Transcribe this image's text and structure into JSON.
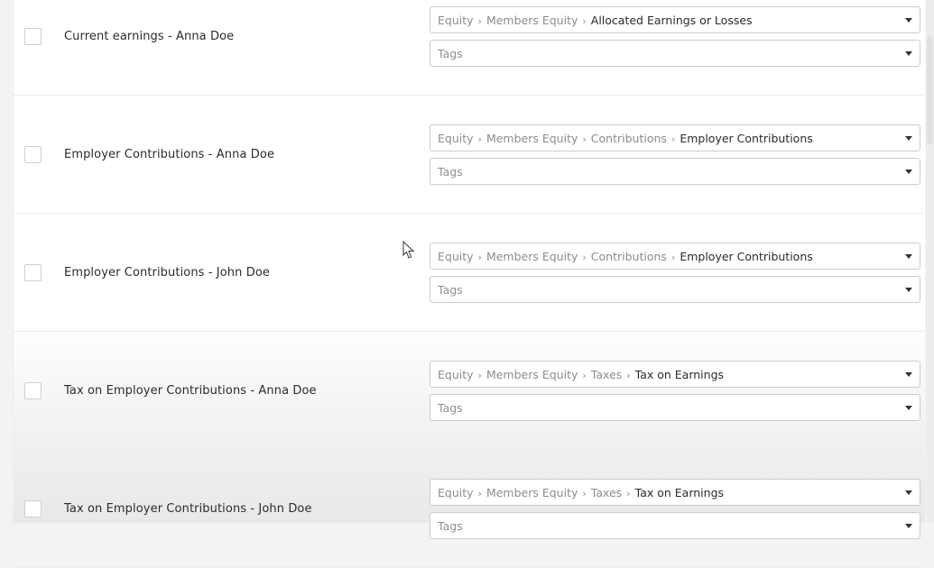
{
  "rows": [
    {
      "label": "Current earnings - Anna Doe",
      "account": {
        "path": [
          "Equity",
          "Members Equity"
        ],
        "final": "Allocated Earnings or Losses"
      },
      "tags_placeholder": "Tags"
    },
    {
      "label": "Employer Contributions - Anna Doe",
      "account": {
        "path": [
          "Equity",
          "Members Equity",
          "Contributions"
        ],
        "final": "Employer Contributions"
      },
      "tags_placeholder": "Tags"
    },
    {
      "label": "Employer Contributions - John Doe",
      "account": {
        "path": [
          "Equity",
          "Members Equity",
          "Contributions"
        ],
        "final": "Employer Contributions"
      },
      "tags_placeholder": "Tags"
    },
    {
      "label": "Tax on Employer Contributions - Anna Doe",
      "account": {
        "path": [
          "Equity",
          "Members Equity",
          "Taxes"
        ],
        "final": "Tax on Earnings"
      },
      "tags_placeholder": "Tags"
    },
    {
      "label": "Tax on Employer Contributions - John Doe",
      "account": {
        "path": [
          "Equity",
          "Members Equity",
          "Taxes"
        ],
        "final": "Tax on Earnings"
      },
      "tags_placeholder": "Tags"
    }
  ],
  "breadcrumb_separator": "›",
  "icons": {
    "dropdown": "chevron-down-icon",
    "pointer": "mouse-pointer-icon"
  }
}
